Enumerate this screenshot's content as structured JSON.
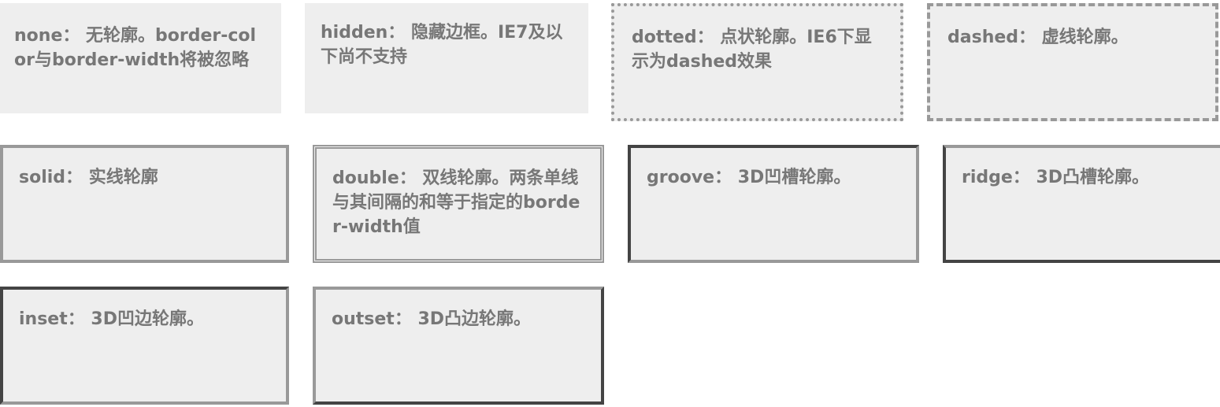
{
  "colors": {
    "page_background": "#ffffff",
    "box_background": "#eeeeee",
    "text": "#777777",
    "border_light": "#999999",
    "border_dark": "#444444"
  },
  "boxes": [
    {
      "style": "none",
      "text": "none： 无轮廓。border-color与border-width将被忽略"
    },
    {
      "style": "hidden",
      "text": "hidden： 隐藏边框。IE7及以下尚不支持"
    },
    {
      "style": "dotted",
      "text": "dotted： 点状轮廓。IE6下显示为dashed效果"
    },
    {
      "style": "dashed",
      "text": "dashed： 虚线轮廓。"
    },
    {
      "style": "solid",
      "text": "solid： 实线轮廓"
    },
    {
      "style": "double",
      "text": "double： 双线轮廓。两条单线与其间隔的和等于指定的border-width值"
    },
    {
      "style": "groove",
      "text": "groove： 3D凹槽轮廓。"
    },
    {
      "style": "ridge",
      "text": "ridge： 3D凸槽轮廓。"
    },
    {
      "style": "inset",
      "text": "inset： 3D凹边轮廓。"
    },
    {
      "style": "outset",
      "text": "outset： 3D凸边轮廓。"
    }
  ]
}
